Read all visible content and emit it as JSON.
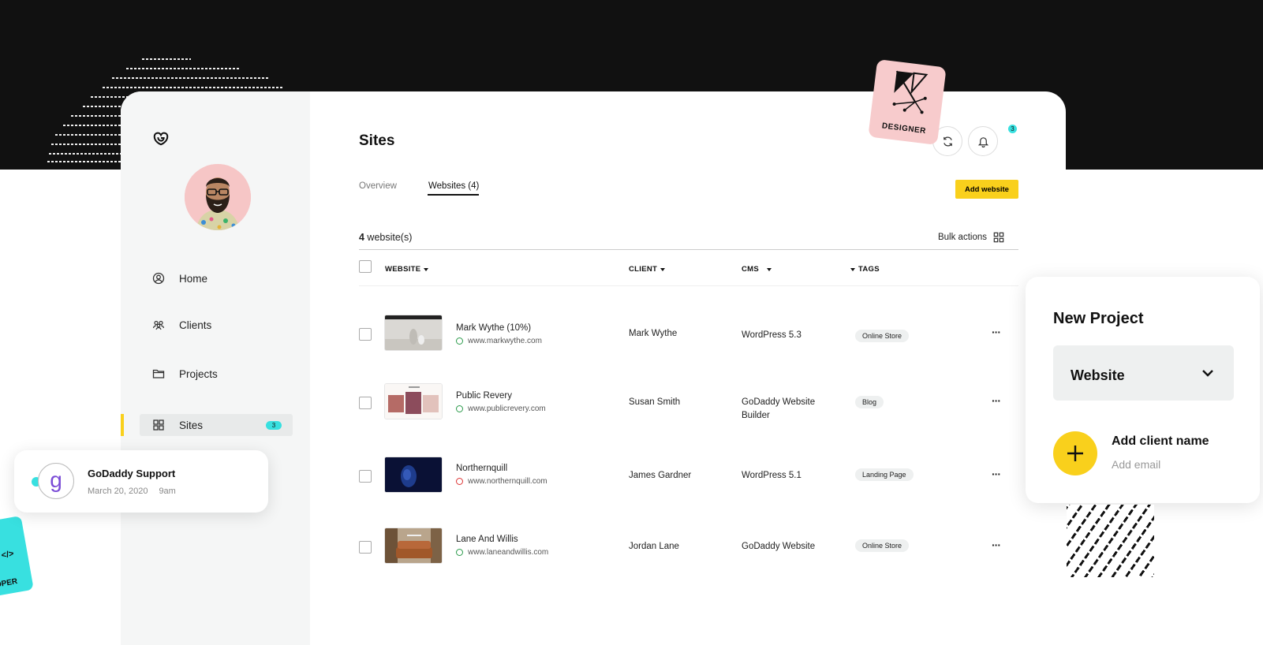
{
  "sidebar": {
    "items": [
      {
        "label": "Home",
        "icon": "user-circle-icon"
      },
      {
        "label": "Clients",
        "icon": "people-icon"
      },
      {
        "label": "Projects",
        "icon": "folder-icon"
      },
      {
        "label": "Sites",
        "icon": "grid-icon",
        "badge": "3"
      }
    ]
  },
  "main": {
    "title": "Sites",
    "tabs": [
      {
        "label": "Overview"
      },
      {
        "label": "Websites (4)"
      }
    ],
    "add_button": "Add website",
    "notification_count": "3",
    "count_number": "4",
    "count_suffix": " website(s)",
    "bulk_actions": "Bulk actions",
    "columns": {
      "website": "WEBSITE",
      "client": "CLIENT",
      "cms": "CMS",
      "tags": "TAGS"
    },
    "rows": [
      {
        "name": "Mark Wythe (10%)",
        "url": "www.markwythe.com",
        "client": "Mark Wythe",
        "cms": "WordPress 5.3",
        "tag": "Online Store",
        "status": "green"
      },
      {
        "name": "Public Revery",
        "url": "www.publicrevery.com",
        "client": "Susan Smith",
        "cms": "GoDaddy Website Builder",
        "tag": "Blog",
        "status": "green"
      },
      {
        "name": "Northernquill",
        "url": "www.northernquill.com",
        "client": "James Gardner",
        "cms": "WordPress 5.1",
        "tag": "Landing Page",
        "status": "red"
      },
      {
        "name": "Lane And Willis",
        "url": "www.laneandwillis.com",
        "client": "Jordan Lane",
        "cms": "GoDaddy Website",
        "tag": "Online Store",
        "status": "green"
      }
    ],
    "more": "···"
  },
  "stickers": {
    "designer": "DESIGNER",
    "developer": "OPER",
    "developer_code": "</>"
  },
  "support": {
    "logo_letter": "g",
    "title": "GoDaddy Support",
    "date": "March 20, 2020",
    "time": "9am"
  },
  "new_project": {
    "title": "New Project",
    "select_value": "Website",
    "client_label": "Add client name",
    "email_placeholder": "Add email"
  },
  "colors": {
    "accent_yellow": "#f9d01c",
    "accent_cyan": "#38e0e0",
    "dark_band": "#111111",
    "designer_pink": "#f7cbcc"
  }
}
